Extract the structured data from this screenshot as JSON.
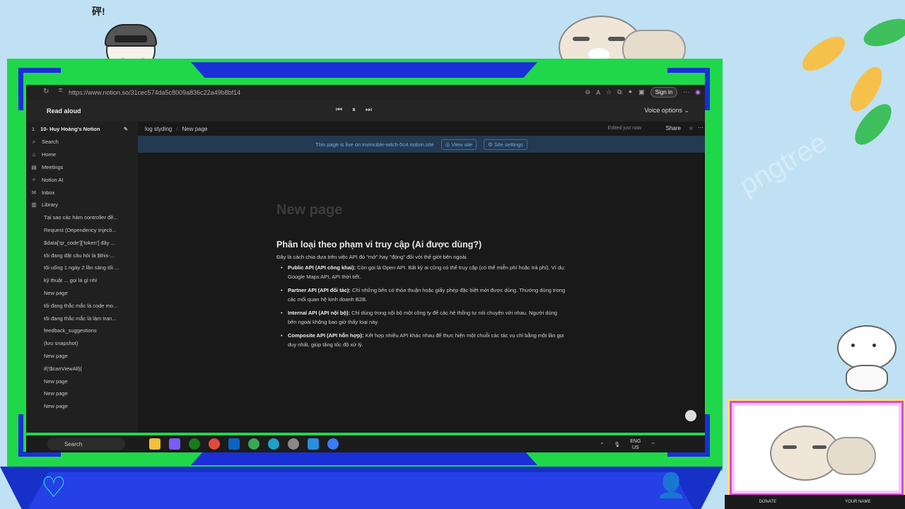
{
  "overlay": {
    "sticker_text": "砰!",
    "donate_label": "DONATE",
    "name_label": "YOUR NAME",
    "bg_watermark": "pngtree",
    "colors": {
      "frame_green": "#1ed84a",
      "frame_blue": "#1a2fd6",
      "accent_cyan": "#1ef0f0"
    }
  },
  "browser": {
    "url": "https://www.notion.so/31cec574da5c8009a836c22a49b8bf14",
    "signin_label": "Sign in"
  },
  "readaloud": {
    "title": "Read aloud",
    "voice_options": "Voice options"
  },
  "sidebar": {
    "workspace": "10- Huy Hoàng's Notion",
    "nav": [
      {
        "label": "Search",
        "icon": "search-icon"
      },
      {
        "label": "Home",
        "icon": "home-icon"
      },
      {
        "label": "Meetings",
        "icon": "meetings-icon"
      },
      {
        "label": "Notion AI",
        "icon": "ai-icon"
      },
      {
        "label": "Inbox",
        "icon": "inbox-icon"
      },
      {
        "label": "Library",
        "icon": "library-icon"
      }
    ],
    "pages": [
      "Tại sao các hàm controller đề...",
      "Request (Dependency Injecti...",
      "$data['qr_code']['token'] đây ...",
      "tôi đang đặt câu hỏi là $this-...",
      "tôi uống 1 ngày 2 lần sáng tối ...",
      "kỹ thuật ... gọi là gì nhỉ",
      "New page",
      "tôi đang thắc mắc là code mo...",
      "tôi đang thắc mắc là làm tran...",
      "feedback_suggestions",
      "(lưu snapshot)",
      "New page",
      "if(!$canViewAll){",
      "New page",
      "New page",
      "New page"
    ]
  },
  "topbar": {
    "breadcrumb1": "log styding",
    "breadcrumb2": "New page",
    "edited": "Edited just now",
    "share": "Share"
  },
  "banner": {
    "text": "This page is live on invincible-witch-5c4.notion.site",
    "view_site": "View site",
    "site_settings": "Site settings"
  },
  "doc": {
    "title_placeholder": "New page",
    "heading": "Phân loại theo phạm vi truy cập (Ai được dùng?)",
    "intro": "Đây là cách chia dựa trên việc API đó \"mở\" hay \"đóng\" đối với thế giới bên ngoài.",
    "items": [
      {
        "term": "Public API (API công khai):",
        "text": " Còn gọi là Open API. Bất kỳ ai cũng có thể truy cập (có thể miễn phí hoặc trả phí). Ví dụ: Google Maps API, API thời tiết."
      },
      {
        "term": "Partner API (API đối tác):",
        "text": " Chỉ những bên có thỏa thuận hoặc giấy phép đặc biệt mới được dùng. Thường dùng trong các mối quan hệ kinh doanh B2B."
      },
      {
        "term": "Internal API (API nội bộ):",
        "text": " Chỉ dùng trong nội bộ một công ty để các hệ thống tự nói chuyện với nhau. Người dùng bên ngoài không bao giờ thấy loại này."
      },
      {
        "term": "Composite API (API hỗn hợp):",
        "text": " Kết hợp nhiều API khác nhau để thực hiện một chuỗi các tác vụ chỉ bằng một lần gọi duy nhất, giúp tăng tốc độ xử lý."
      }
    ]
  },
  "taskbar": {
    "search": "Search",
    "lang": "ENG",
    "region": "US"
  }
}
